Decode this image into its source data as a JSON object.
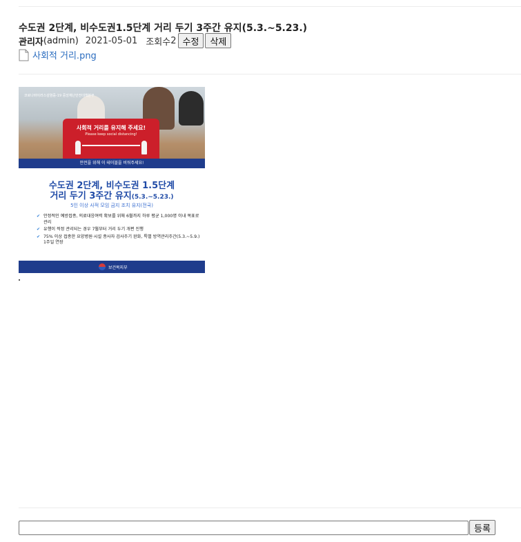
{
  "post": {
    "title": "수도권 2단계, 비수도권1.5단계 거리 두기 3주간 유지(5.3.~5.23.)",
    "author_name": "관리자",
    "author_id": "(admin)",
    "date": "2021-05-01",
    "views_label": "조회수",
    "views_count": "2",
    "edit_label": "수정",
    "delete_label": "삭제"
  },
  "attachment": {
    "filename": "사회적 거리.png",
    "icon": "file-icon"
  },
  "poster": {
    "corner_text": "코로나바이러스감염증-19 중앙재난안전대책본부",
    "sign_title": "사회적 거리를 유지해 주세요!",
    "sign_sub": "Please keep social distancing!",
    "photo_caption": "안전을 위해 이 테이블을 비워주세요!",
    "heading_line1": "수도권 2단계, 비수도권 1.5단계",
    "heading_line2": "거리 두기 3주간 유지",
    "heading_dates": "(5.3.~5.23.)",
    "subheading": "5인 이상 사적 모임 금지 조치 유지(전국)",
    "bullets": [
      "안정적인 예방접종, 의료대응여력 확보를 위해 6월까지 하루 평균 1,000명 이내 목표로 관리",
      "유행이 적정 관리되는 경우 7월부터 거리 두기 개편 진행",
      "75% 이상 접종한 요양병원·시설 종사자 검사주기 완화, 특별 방역관리주간(5.3.~5.9.) 1주일 연장"
    ],
    "org": "보건복지부"
  },
  "comment": {
    "input_value": "",
    "submit_label": "등록"
  }
}
